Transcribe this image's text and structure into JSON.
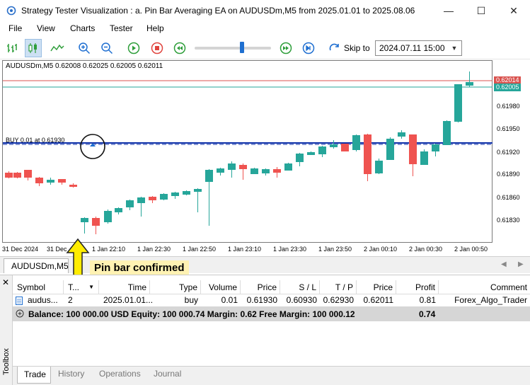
{
  "window": {
    "title": "Strategy Tester Visualization : a. Pin Bar Averaging EA on AUDUSDm,M5 from 2025.01.01 to 2025.08.06",
    "minimize_glyph": "—",
    "maximize_glyph": "☐",
    "close_glyph": "✕"
  },
  "menu": [
    "File",
    "View",
    "Charts",
    "Tester",
    "Help"
  ],
  "toolbar": {
    "skip_to_label": "Skip to",
    "skip_to_value": "2024.07.11 15:00",
    "speed_level": 0.62
  },
  "chart": {
    "header": "AUDUSDm,M5  0.62008 0.62025 0.62005 0.62011",
    "position_label": "BUY 0.01 at 0.61930",
    "price_ticks": [
      "0.61980",
      "0.61950",
      "0.61920",
      "0.61890",
      "0.61860",
      "0.61830"
    ],
    "ask_price": "0.62014",
    "bid_price": "0.62005",
    "time_ticks": [
      "31 Dec 2024",
      "31 Dec",
      "1 Jan 22:10",
      "1 Jan 22:30",
      "1 Jan 22:50",
      "1 Jan 23:10",
      "1 Jan 23:30",
      "1 Jan 23:50",
      "2 Jan 00:10",
      "2 Jan 00:30",
      "2 Jan 00:50"
    ],
    "colors": {
      "bull": "#26a69a",
      "bear": "#ef5350",
      "position_line": "#0d2fa8",
      "ask_line": "#d9534f",
      "bid_line": "#26a69a"
    }
  },
  "chart_tab": {
    "label": "AUDUSDm,M5"
  },
  "annotation": {
    "text": "Pin bar confirmed"
  },
  "trade_table": {
    "columns": [
      "Symbol",
      "T...",
      "Time",
      "Type",
      "Volume",
      "Price",
      "S / L",
      "T / P",
      "Price",
      "Profit",
      "Comment"
    ],
    "row": {
      "symbol": "audus...",
      "ticket": "2",
      "time": "2025.01.01...",
      "type": "buy",
      "volume": "0.01",
      "price": "0.61930",
      "sl": "0.60930",
      "tp": "0.62930",
      "current_price": "0.62011",
      "profit": "0.81",
      "comment": "Forex_Algo_Trader"
    },
    "balance_text": "Balance: 100 000.00 USD  Equity: 100 000.74  Margin: 0.62  Free Margin: 100 000.12",
    "balance_profit": "0.74"
  },
  "toolbox": {
    "label": "Toolbox",
    "tabs": [
      "Trade",
      "History",
      "Operations",
      "Journal"
    ]
  }
}
